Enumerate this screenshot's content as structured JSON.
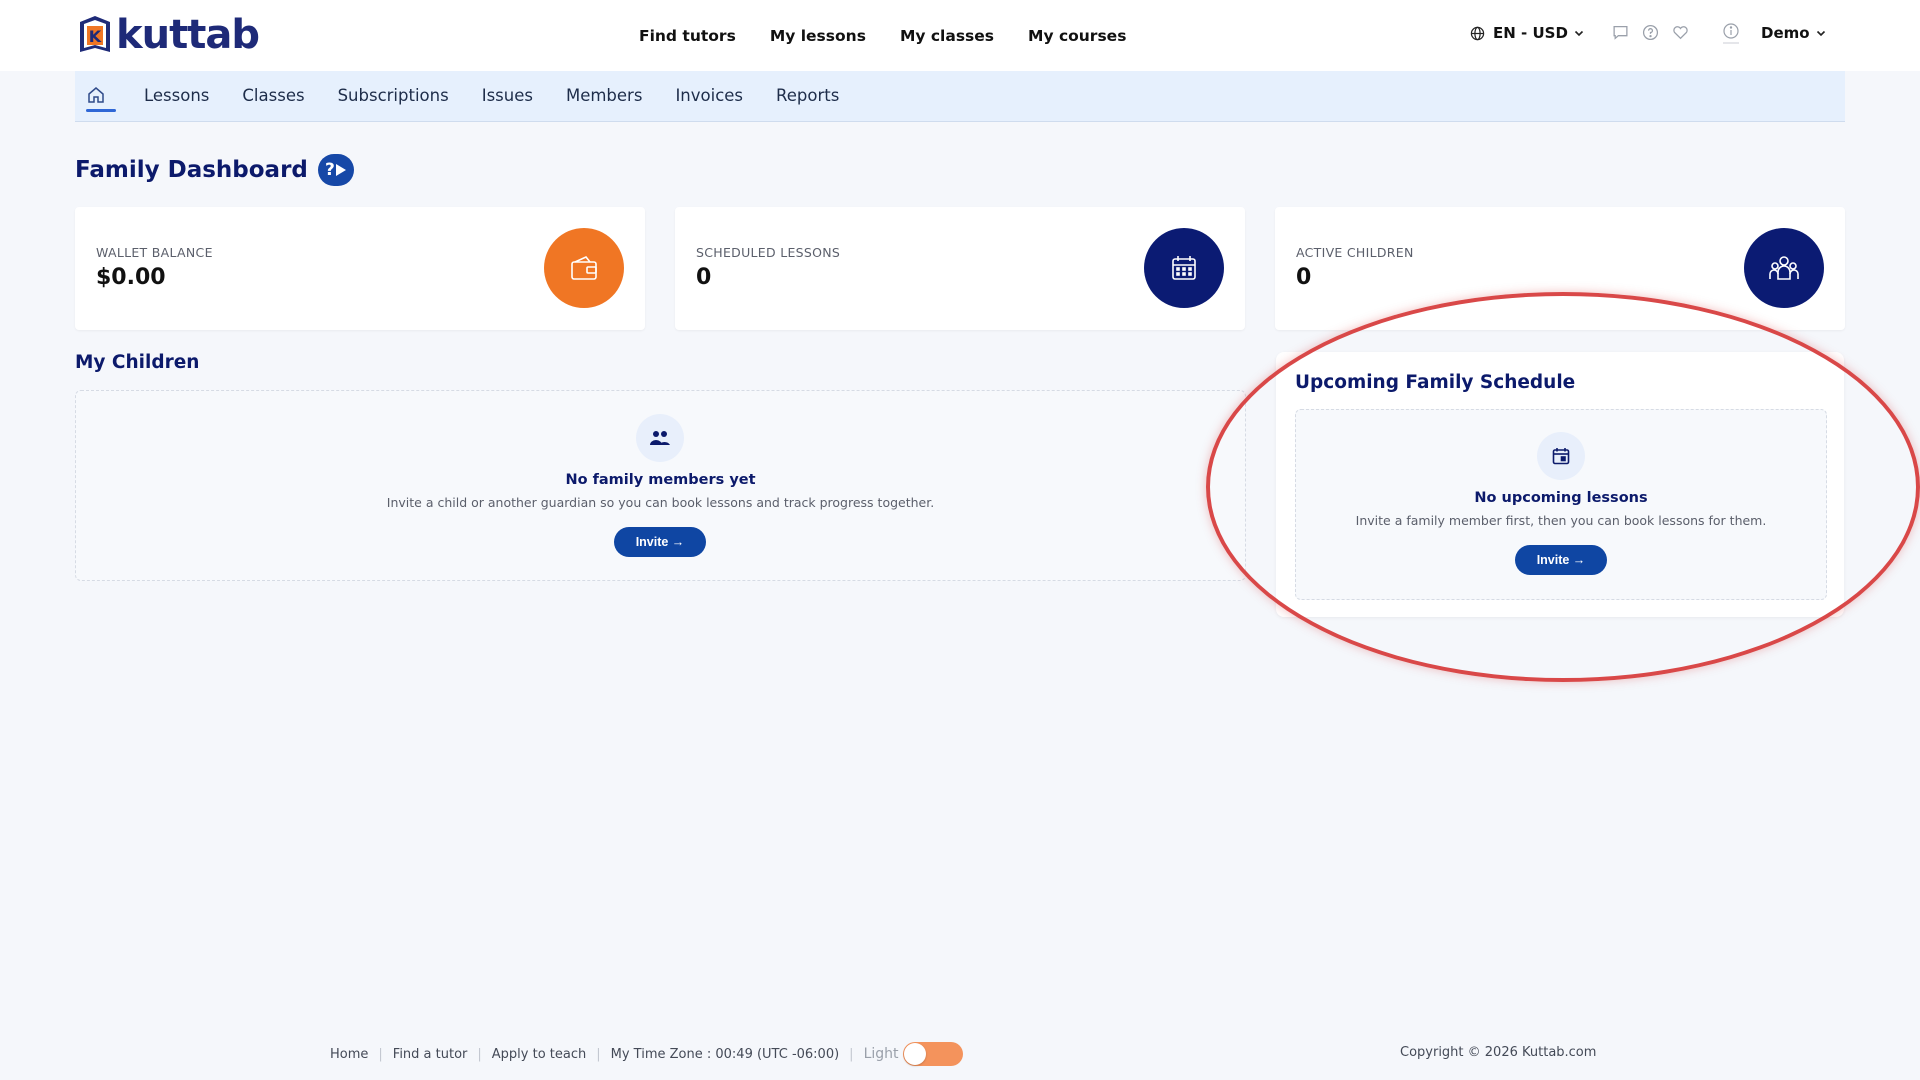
{
  "brand": {
    "name": "kuttab",
    "mark_letter": "K"
  },
  "main_nav": [
    "Find tutors",
    "My lessons",
    "My classes",
    "My courses"
  ],
  "language_currency": "EN - USD",
  "user": {
    "name": "Demo"
  },
  "sub_nav": [
    "Lessons",
    "Classes",
    "Subscriptions",
    "Issues",
    "Members",
    "Invoices",
    "Reports"
  ],
  "page_title": "Family Dashboard",
  "help_badge": "?",
  "stats": [
    {
      "label": "WALLET BALANCE",
      "value": "$0.00",
      "icon": "wallet-icon",
      "color": "#f07624"
    },
    {
      "label": "SCHEDULED LESSONS",
      "value": "0",
      "icon": "calendar-icon",
      "color": "#0b1b73"
    },
    {
      "label": "ACTIVE CHILDREN",
      "value": "0",
      "icon": "family-icon",
      "color": "#0b1b73"
    }
  ],
  "children": {
    "title": "My Children",
    "empty_title": "No family members yet",
    "empty_text": "Invite a child or another guardian so you can book lessons and track progress together.",
    "button": "Invite →"
  },
  "schedule": {
    "title": "Upcoming Family Schedule",
    "empty_title": "No upcoming lessons",
    "empty_text": "Invite a family member first, then you can book lessons for them.",
    "button": "Invite →"
  },
  "footer": {
    "links": [
      "Home",
      "Find a tutor",
      "Apply to teach"
    ],
    "timezone": "My Time Zone : 00:49 (UTC -06:00)",
    "theme_label": "Light",
    "copyright": "Copyright © 2026 Kuttab.com"
  },
  "colors": {
    "accent": "#0f46a3",
    "navy": "#0c1a6b",
    "orange": "#f07624",
    "highlight": "#d94848"
  }
}
